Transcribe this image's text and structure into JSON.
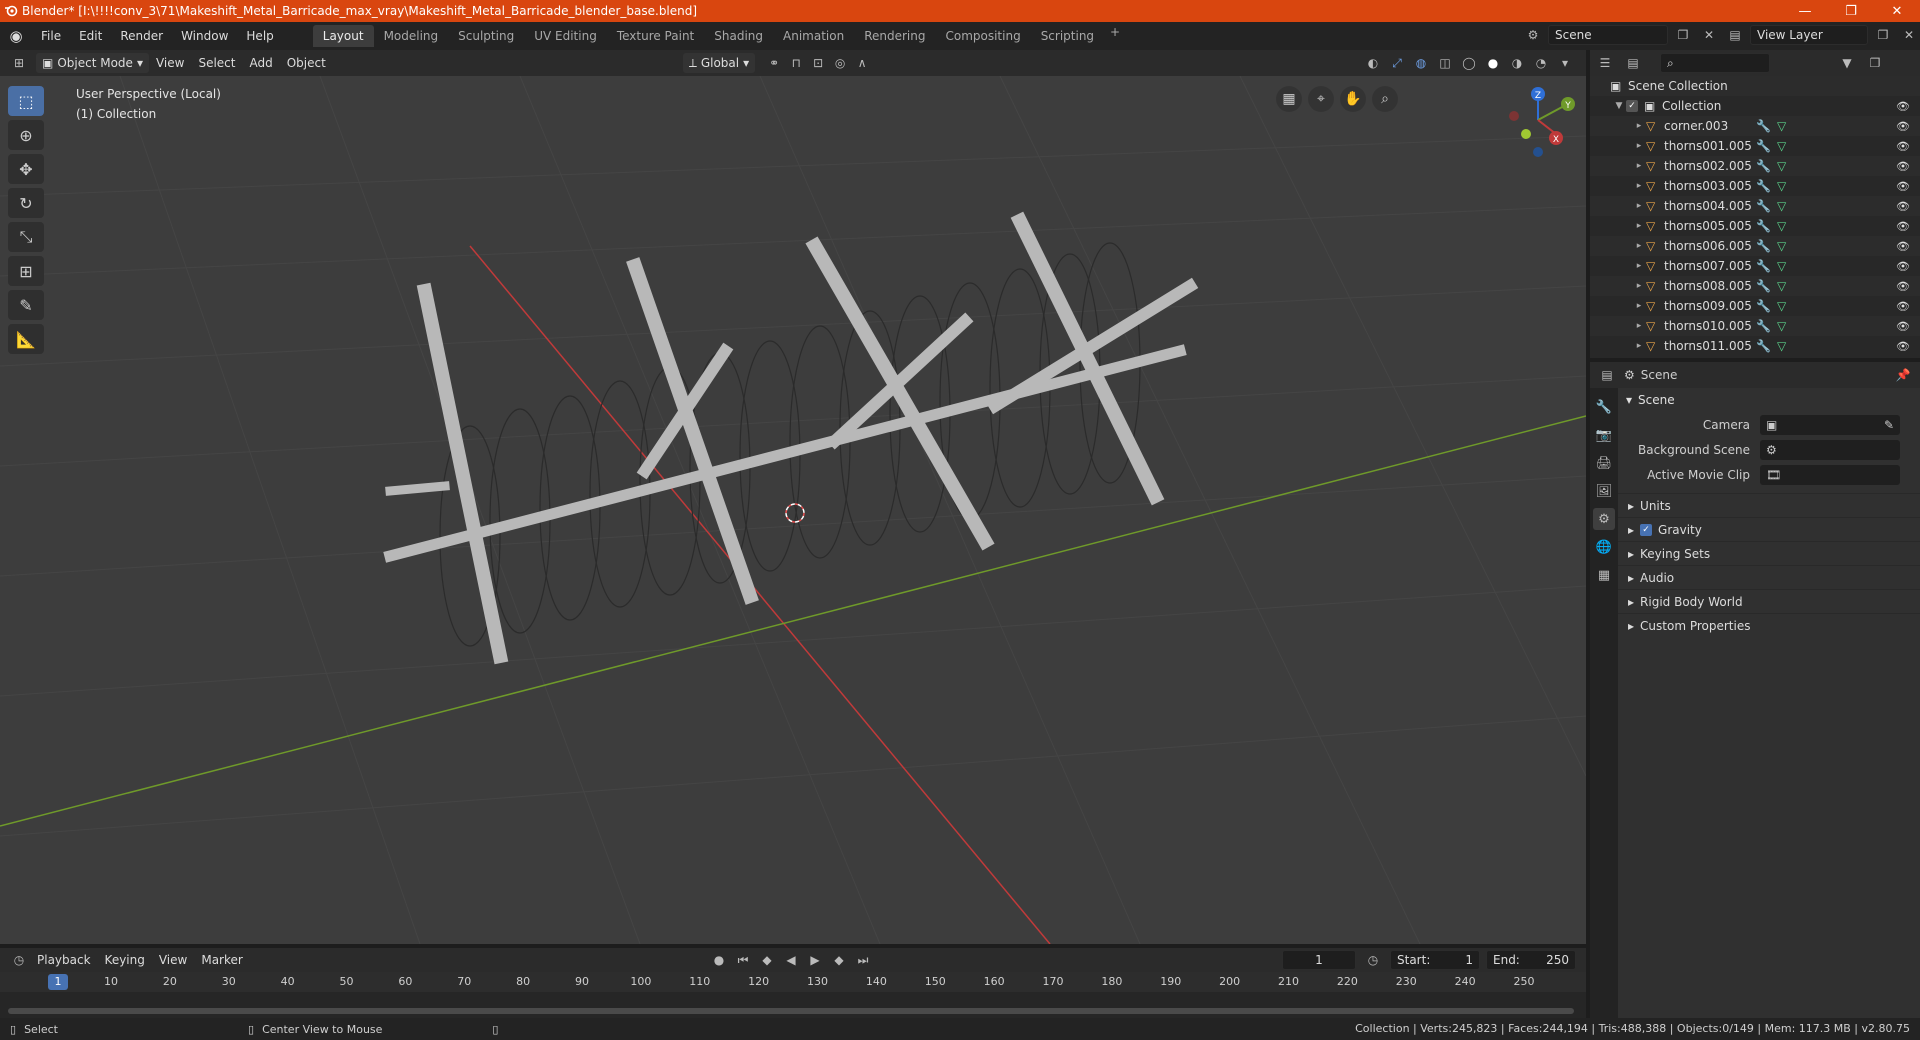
{
  "window": {
    "title": "Blender* [I:\\!!!!conv_3\\71\\Makeshift_Metal_Barricade_max_vray\\Makeshift_Metal_Barricade_blender_base.blend]",
    "controls": [
      "—",
      "❐",
      "✕"
    ]
  },
  "menu": [
    "File",
    "Edit",
    "Render",
    "Window",
    "Help"
  ],
  "workspaces": [
    "Layout",
    "Modeling",
    "Sculpting",
    "UV Editing",
    "Texture Paint",
    "Shading",
    "Animation",
    "Rendering",
    "Compositing",
    "Scripting"
  ],
  "active_workspace": "Layout",
  "scene_field": "Scene",
  "view_layer_field": "View Layer",
  "viewport_header": {
    "mode": "Object Mode",
    "menus": [
      "View",
      "Select",
      "Add",
      "Object"
    ],
    "transform_orientation": "Global"
  },
  "viewport": {
    "perspective_label": "User Perspective (Local)",
    "collection_label": "(1) Collection",
    "gizmo_axes": {
      "x": "X",
      "y": "Y",
      "z": "Z"
    }
  },
  "outliner": {
    "root": "Scene Collection",
    "collection": "Collection",
    "objects": [
      "corner.003",
      "thorns001.005",
      "thorns002.005",
      "thorns003.005",
      "thorns004.005",
      "thorns005.005",
      "thorns006.005",
      "thorns007.005",
      "thorns008.005",
      "thorns009.005",
      "thorns010.005",
      "thorns011.005"
    ]
  },
  "properties": {
    "header_label": "Scene",
    "panel_title": "Scene",
    "fields": [
      {
        "label": "Camera",
        "value": ""
      },
      {
        "label": "Background Scene",
        "value": ""
      },
      {
        "label": "Active Movie Clip",
        "value": ""
      }
    ],
    "subpanels": [
      "Units",
      "Gravity",
      "Keying Sets",
      "Audio",
      "Rigid Body World",
      "Custom Properties"
    ],
    "gravity_checked": true
  },
  "timeline": {
    "menus": [
      "Playback",
      "Keying",
      "View",
      "Marker"
    ],
    "current_frame": "1",
    "start_label": "Start:",
    "start": "1",
    "end_label": "End:",
    "end": "250",
    "ticks": [
      "1",
      "10",
      "20",
      "30",
      "40",
      "50",
      "60",
      "70",
      "80",
      "90",
      "100",
      "110",
      "120",
      "130",
      "140",
      "150",
      "160",
      "170",
      "180",
      "190",
      "200",
      "210",
      "220",
      "230",
      "240",
      "250"
    ]
  },
  "statusbar": {
    "left1": "Select",
    "left2": "Center View to Mouse",
    "right": "Collection | Verts:245,823 | Faces:244,194 | Tris:488,388 | Objects:0/149 | Mem: 117.3 MB | v2.80.75"
  },
  "colors": {
    "title_bar": "#d9460f",
    "accent_blue": "#4772b3",
    "axis_x": "#c03a3a",
    "axis_y": "#6f9a2a",
    "axis_z": "#2f6fd6"
  }
}
